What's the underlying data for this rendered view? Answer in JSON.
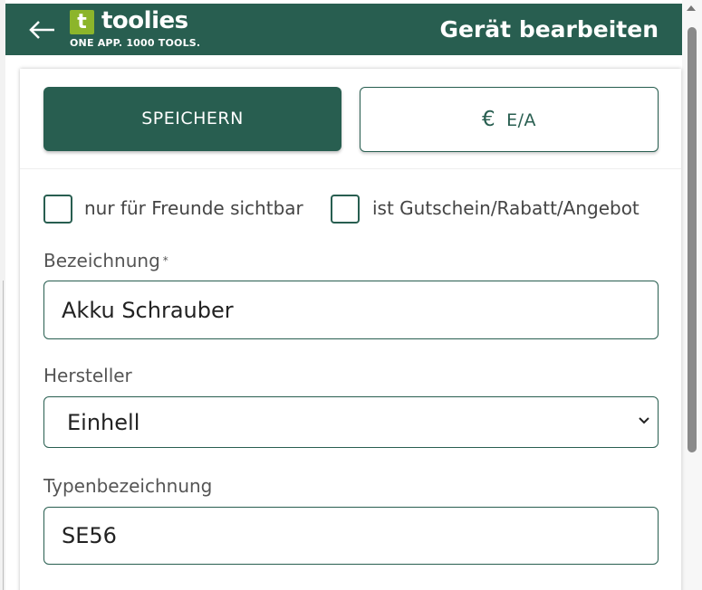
{
  "header": {
    "logo_mark": "t",
    "logo_text": "toolies",
    "logo_tagline": "ONE APP. 1000 TOOLS.",
    "title": "Gerät bearbeiten"
  },
  "actions": {
    "save_label": "SPEICHERN",
    "ea_icon": "€",
    "ea_label": "E/A"
  },
  "checkboxes": [
    {
      "label": "nur für Freunde sichtbar",
      "checked": false
    },
    {
      "label": "ist Gutschein/Rabatt/Angebot",
      "checked": false
    }
  ],
  "fields": {
    "bezeichnung": {
      "label": "Bezeichnung",
      "required_mark": "*",
      "value": "Akku Schrauber"
    },
    "hersteller": {
      "label": "Hersteller",
      "value": "Einhell"
    },
    "typenbezeichnung": {
      "label": "Typenbezeichnung",
      "value": "SE56"
    }
  },
  "colors": {
    "primary": "#285e50",
    "logo_green": "#8cb52b"
  }
}
